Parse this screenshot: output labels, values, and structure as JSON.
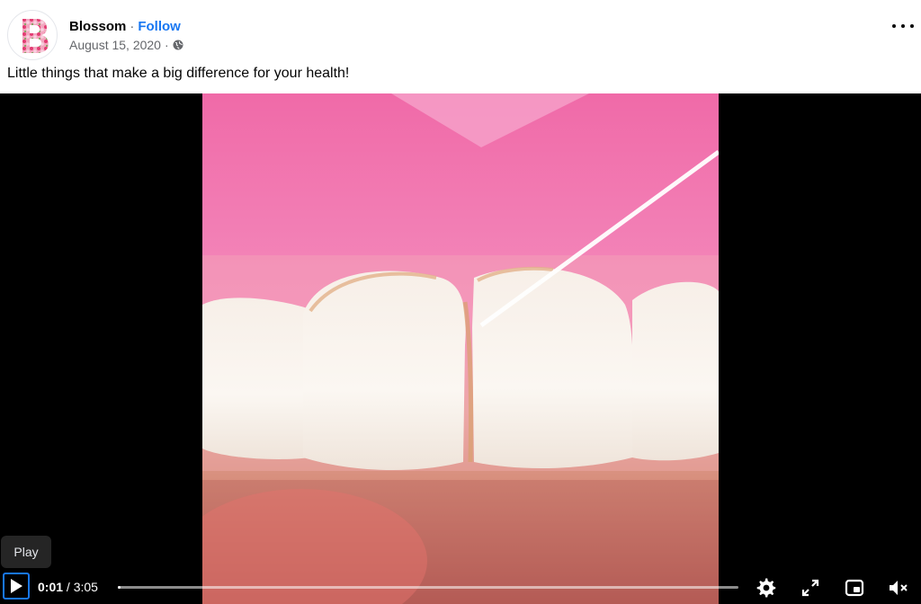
{
  "post": {
    "author": "Blossom",
    "separator": "·",
    "follow_label": "Follow",
    "date": "August 15, 2020",
    "date_separator": "·",
    "caption": "Little things that make a big difference for your health!",
    "avatar_letter": "B",
    "avatar_color": "#e8608a"
  },
  "icons": {
    "privacy": "globe-icon",
    "more": "more-options-icon",
    "play": "play-icon",
    "settings": "gear-icon",
    "fullscreen": "expand-icon",
    "pip": "picture-in-picture-icon",
    "volume": "muted-speaker-icon"
  },
  "video": {
    "tooltip": "Play",
    "current_time": "0:01",
    "time_separator": " / ",
    "duration": "3:05",
    "progress_fraction": 0.005
  },
  "colors": {
    "accent": "#1877f2",
    "text_primary": "#050505",
    "text_secondary": "#65676b"
  }
}
